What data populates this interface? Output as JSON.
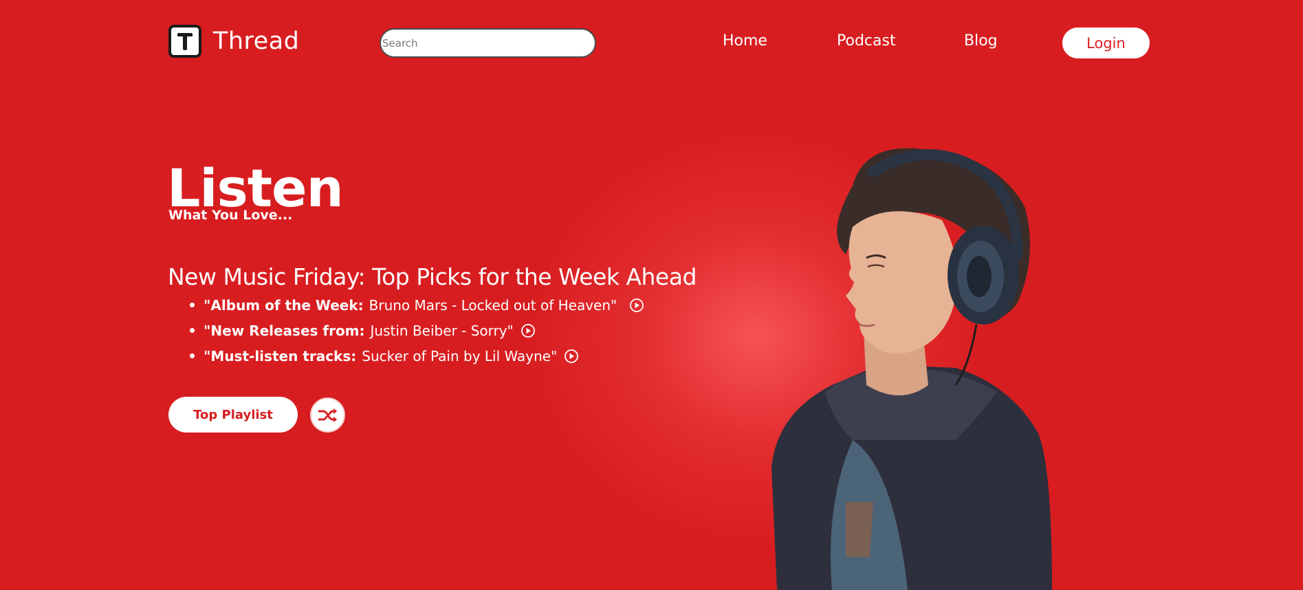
{
  "brand": {
    "name": "Thread",
    "logo_letter": "T",
    "accent_color": "#d81d20"
  },
  "search": {
    "placeholder": "Search",
    "icon": "none"
  },
  "nav": {
    "items": [
      "Home",
      "Podcast",
      "Blog"
    ],
    "login_label": "Login"
  },
  "hero": {
    "title": "Listen",
    "subtitle": "What You Love...",
    "headline": "New Music Friday: Top Picks for the Week Ahead",
    "picks": [
      {
        "label": "\"Album of the Week:",
        "text": "Bruno Mars - Locked out of Heaven\"",
        "icon": "play-circle-icon"
      },
      {
        "label": "\"New Releases from:",
        "text": "Justin Beiber - Sorry\"",
        "icon": "play-circle-icon"
      },
      {
        "label": "\"Must-listen tracks:",
        "text": "Sucker of Pain by Lil Wayne\"",
        "icon": "play-circle-icon"
      }
    ],
    "playlist_button": "Top Playlist",
    "shuffle_icon": "shuffle-icon"
  },
  "image": {
    "subject": "woman-with-headphones-illustration"
  }
}
